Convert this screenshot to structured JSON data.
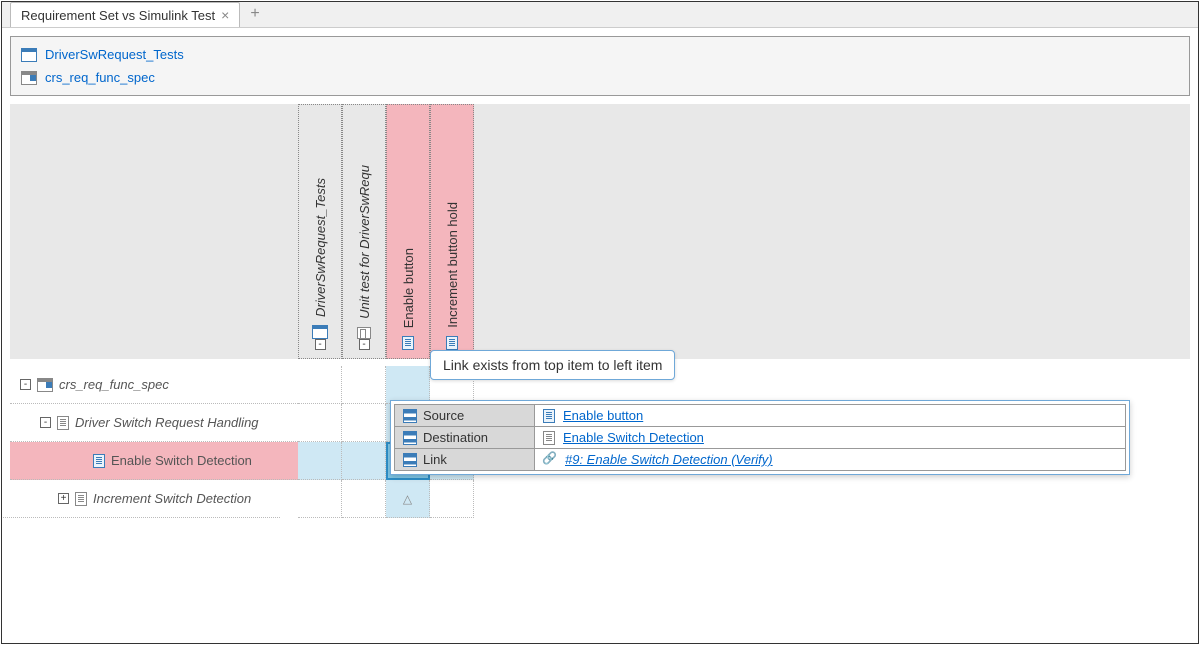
{
  "tab": {
    "title": "Requirement Set vs Simulink Test"
  },
  "artifacts": [
    {
      "name": "DriverSwRequest_Tests"
    },
    {
      "name": "crs_req_func_spec"
    }
  ],
  "columns": [
    {
      "label": "DriverSwRequest_Tests",
      "highlighted": false
    },
    {
      "label": "Unit test for DriverSwRequ",
      "highlighted": false
    },
    {
      "label": "Enable button",
      "highlighted": true
    },
    {
      "label": "Increment button hold",
      "highlighted": true
    }
  ],
  "rows": [
    {
      "label": "crs_req_func_spec",
      "level": 0,
      "toggle": "-",
      "highlighted": false
    },
    {
      "label": "Driver Switch Request Handling",
      "level": 1,
      "toggle": "-",
      "highlighted": false
    },
    {
      "label": "Enable Switch Detection",
      "level": 2,
      "toggle": "",
      "highlighted": true
    },
    {
      "label": "Increment Switch Detection",
      "level": 2,
      "toggle": "+",
      "highlighted": false
    }
  ],
  "tooltip": "Link exists from top item to left item",
  "details": {
    "source": {
      "label": "Source",
      "value": "Enable button"
    },
    "destination": {
      "label": "Destination",
      "value": "Enable Switch Detection"
    },
    "link": {
      "label": "Link",
      "value": "#9: Enable Switch Detection (Verify)"
    }
  }
}
